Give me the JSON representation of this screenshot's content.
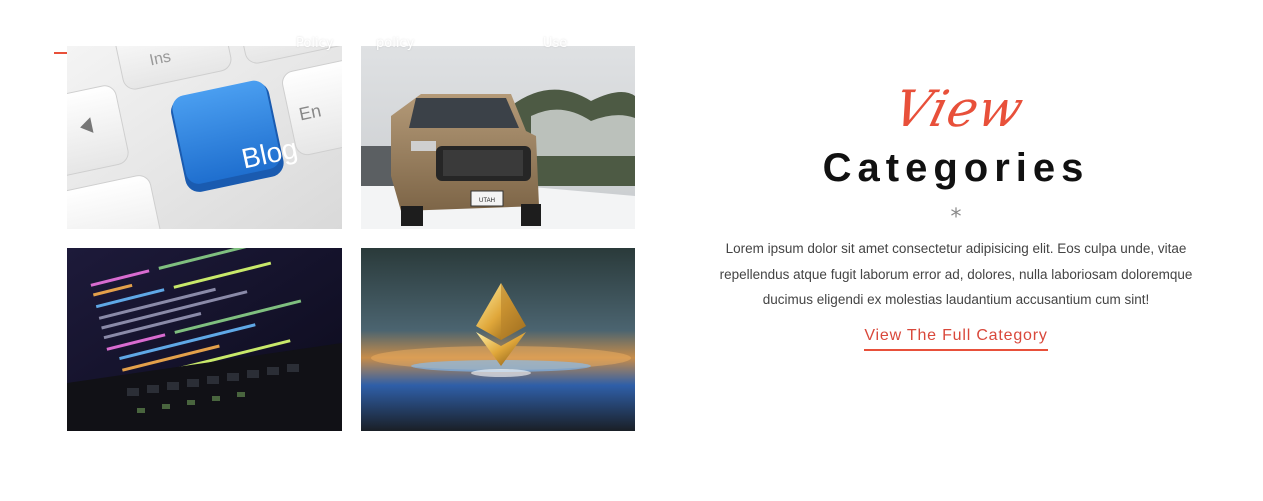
{
  "nav": {
    "items": [
      {
        "line1": "",
        "line2": ""
      },
      {
        "line1": "",
        "line2": "Policy"
      },
      {
        "line1": "",
        "line2": "policy"
      },
      {
        "line1": "",
        "line2": ""
      },
      {
        "line1": "",
        "line2": "Use"
      }
    ]
  },
  "tiles": {
    "blog_key_label": "Blog",
    "plate_text": "UTAH"
  },
  "category": {
    "script_word": "View",
    "title": "Categories",
    "separator": "*",
    "description": "Lorem ipsum dolor sit amet consectetur adipisicing elit. Eos culpa unde, vitae repellendus atque fugit laborum error ad, dolores, nulla laboriosam doloremque ducimus eligendi ex molestias laudantium accusantium cum sint!",
    "cta_label": "View The Full Category"
  },
  "colors": {
    "accent": "#e8503a",
    "heading": "#111111",
    "body_text": "#444444"
  }
}
